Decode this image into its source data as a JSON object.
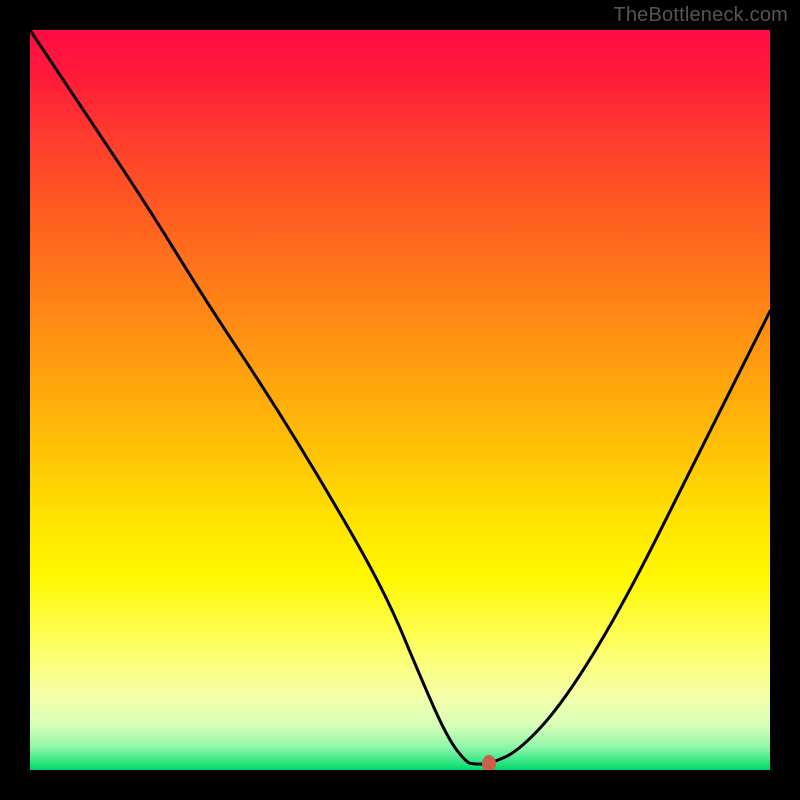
{
  "watermark": "TheBottleneck.com",
  "chart_data": {
    "type": "line",
    "title": "",
    "xlabel": "",
    "ylabel": "",
    "xlim": [
      0,
      100
    ],
    "ylim": [
      0,
      100
    ],
    "grid": false,
    "legend": false,
    "series": [
      {
        "name": "bottleneck-curve",
        "x": [
          0,
          8,
          16,
          24,
          32,
          40,
          48,
          53,
          56.5,
          59,
          60,
          62,
          66,
          72,
          80,
          90,
          100
        ],
        "values": [
          100,
          88,
          76,
          63,
          51,
          38,
          24,
          12,
          4.2,
          1.0,
          0.8,
          0.8,
          2.5,
          9,
          22,
          42,
          62
        ]
      }
    ],
    "marker": {
      "x": 62,
      "y": 0.8,
      "color": "#cc5f4a"
    },
    "background": "rainbow-vertical"
  }
}
